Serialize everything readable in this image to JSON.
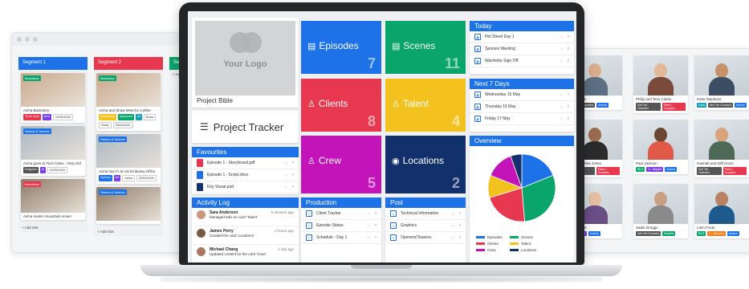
{
  "segments": [
    {
      "title": "Segment 1",
      "color": "#1d72e8",
      "cards": [
        {
          "tag": "Backstory",
          "tag_color": "#0aa56b",
          "title": "Aicha Backstory",
          "pills": [
            {
              "text": "To be shot",
              "color": "#e8384f"
            },
            {
              "text": "Aich",
              "color": "#7b3fe4"
            },
            {
              "text": "10/05/2020",
              "color": "#ffffff"
            }
          ]
        },
        {
          "tag": "Stories & Scenes",
          "tag_color": "#1d72e8",
          "title": "Aicha goes to Tech Class - Only Girl",
          "pills": [
            {
              "text": "Dropped",
              "color": "#555555"
            },
            {
              "text": "Al",
              "color": "#7b3fe4"
            },
            {
              "text": "02/05/2020",
              "color": "#ffffff"
            }
          ]
        },
        {
          "tag": "Interviews",
          "tag_color": "#e8384f",
          "title": "Aicha meets Anoushah Ansari",
          "pills": []
        }
      ],
      "add_label": "+ Add Slot"
    },
    {
      "title": "Segment 2",
      "color": "#e8384f",
      "cards": [
        {
          "tag": "Backstory",
          "tag_color": "#0aa56b",
          "title": "Aicha and Shiva Meet for Coffee",
          "pills": [
            {
              "text": "Melbourne",
              "color": "#f4c21f"
            },
            {
              "text": "Approved",
              "color": "#0aa56b"
            },
            {
              "text": "Al",
              "color": "#17a2b8"
            },
            {
              "text": "Aicha",
              "color": "#ffffff"
            },
            {
              "text": "Shiva",
              "color": "#ffffff"
            },
            {
              "text": "25/04/2020",
              "color": "#ffffff"
            }
          ]
        },
        {
          "tag": "Stories & Scenes",
          "tag_color": "#1d72e8",
          "title": "Aicha has Fr at US Embassy Office",
          "pills": [
            {
              "text": "Sydney",
              "color": "#1d72e8"
            },
            {
              "text": "Ari",
              "color": "#7b3fe4"
            },
            {
              "text": "Aicha",
              "color": "#ffffff"
            },
            {
              "text": "20/04/2020",
              "color": "#ffffff"
            }
          ]
        },
        {
          "tag": "Stories & Scenes",
          "tag_color": "#1d72e8",
          "title": "",
          "pills": []
        }
      ],
      "add_label": "+ Add Slot"
    },
    {
      "title": "Segm",
      "color": "#0aa56b",
      "cards": [],
      "add_label": "+ Add"
    }
  ],
  "talent_cards": [
    {
      "name": "nd Adams",
      "pills": [
        {
          "text": "Not Yet Granted",
          "color": "#555555"
        },
        {
          "text": "Actors",
          "color": "#1d72e8"
        }
      ]
    },
    {
      "name": "Philip and Tess Clarke",
      "pills": [
        {
          "text": "Not Yet Granted",
          "color": "#555555"
        },
        {
          "text": "Pairs / Couples",
          "color": "#e8384f"
        }
      ]
    },
    {
      "name": "Katie Stephens",
      "pills": [
        {
          "text": "Hold",
          "color": "#17a2b8"
        },
        {
          "text": "Not Yet Granted",
          "color": "#555555"
        },
        {
          "text": "Actors",
          "color": "#1d72e8"
        }
      ]
    },
    {
      "name": "and Matthew Jones",
      "pills": [
        {
          "text": "Not Yet Granted",
          "color": "#555555"
        },
        {
          "text": "Pairs / Couples",
          "color": "#e8384f"
        }
      ]
    },
    {
      "name": "Paul Jackson",
      "pills": [
        {
          "text": "BLH",
          "color": "#0aa56b"
        },
        {
          "text": "3 - Maybe",
          "color": "#7b3fe4"
        },
        {
          "text": "Actors",
          "color": "#1d72e8"
        }
      ]
    },
    {
      "name": "Hannah and Will Dixon",
      "pills": [
        {
          "text": "Not Yet Granted",
          "color": "#555555"
        },
        {
          "text": "Pairs / Couples",
          "color": "#e8384f"
        }
      ]
    },
    {
      "name": "ie Thimble",
      "pills": [
        {
          "text": "3 - Maybe",
          "color": "#7b3fe4"
        },
        {
          "text": "Actors",
          "color": "#1d72e8"
        }
      ]
    },
    {
      "name": "Sadie Greggs",
      "pills": [
        {
          "text": "Not Yet Granted",
          "color": "#555555"
        },
        {
          "text": "Models",
          "color": "#0aa56b"
        }
      ]
    },
    {
      "name": "Liam Fouts",
      "pills": [
        {
          "text": "BLR",
          "color": "#0aa56b"
        },
        {
          "text": "1 - Serious",
          "color": "#f07d1a"
        },
        {
          "text": "Actors",
          "color": "#1d72e8"
        }
      ]
    }
  ],
  "project": {
    "logo_text": "Your Logo",
    "bible_label": "Project Bible",
    "tracker_label": "Project Tracker",
    "tracker_icon": "list-icon"
  },
  "tiles": [
    {
      "label": "Episodes",
      "count": "7",
      "color": "#1d72e8",
      "icon": "document-icon"
    },
    {
      "label": "Scenes",
      "count": "11",
      "color": "#0aa56b",
      "icon": "document-icon"
    },
    {
      "label": "Clients",
      "count": "8",
      "color": "#e8384f",
      "icon": "person-icon"
    },
    {
      "label": "Talent",
      "count": "4",
      "color": "#f4c21f",
      "icon": "person-icon"
    },
    {
      "label": "Crew",
      "count": "5",
      "color": "#c214b8",
      "icon": "person-icon"
    },
    {
      "label": "Locations",
      "count": "2",
      "color": "#12306b",
      "icon": "pin-icon"
    }
  ],
  "today": {
    "title": "Today",
    "color": "#1d72e8",
    "items": [
      "Hot Sheet Day 1",
      "Sponsor Meeting",
      "Wardrobe Sign Off"
    ]
  },
  "next7": {
    "title": "Next 7 Days",
    "color": "#1d72e8",
    "items": [
      "Wednesday 15 May",
      "Thursday 16 May",
      "Friday 17 May"
    ]
  },
  "favourites": {
    "title": "Favourites",
    "color": "#1d72e8",
    "items": [
      {
        "label": "Episode 1 - Storyboard.pdf",
        "icon_color": "#e8384f"
      },
      {
        "label": "Episode 1 - Script.docx",
        "icon_color": "#1d72e8"
      },
      {
        "label": "Key Visual.psd",
        "icon_color": "#12306b"
      }
    ]
  },
  "activity": {
    "title": "Activity Log",
    "color": "#1d72e8",
    "items": [
      {
        "name": "Sara Anderson",
        "desc": "Managed tabs on card 'Talent'",
        "time": "5 minutes ago"
      },
      {
        "name": "James Perry",
        "desc": "Created the card 'Locations'",
        "time": "2 hours ago"
      },
      {
        "name": "Michael Chang",
        "desc": "Updated content for the card 'Crew'",
        "time": "1 day ago"
      }
    ]
  },
  "production": {
    "title": "Production",
    "color": "#1d72e8",
    "items": [
      "Client Tracker",
      "Episode Status",
      "Schedule - Day 1"
    ]
  },
  "post": {
    "title": "Post",
    "color": "#1d72e8",
    "items": [
      "Technical Information",
      "Graphics",
      "Openers/Teasers"
    ]
  },
  "overview": {
    "title": "Overview",
    "color": "#1d72e8"
  },
  "chart_data": {
    "type": "pie",
    "title": "Overview",
    "categories": [
      "Episodes",
      "Scenes",
      "Clients",
      "Talent",
      "Crew",
      "Locations"
    ],
    "values": [
      7,
      11,
      8,
      4,
      5,
      2
    ],
    "colors": [
      "#1d72e8",
      "#0aa56b",
      "#e8384f",
      "#f4c21f",
      "#c214b8",
      "#12306b"
    ],
    "legend_position": "bottom"
  }
}
